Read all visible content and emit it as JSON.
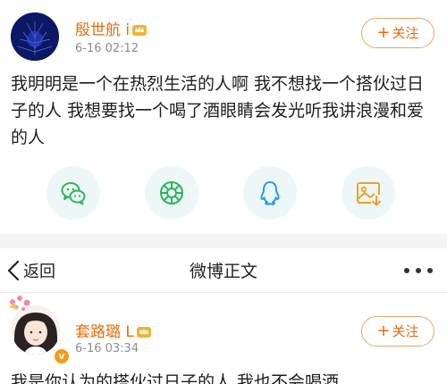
{
  "post1": {
    "username": "殷世航 i",
    "timestamp": "6-16 02:12",
    "follow_plus": "+",
    "follow_label": "关注",
    "text": "我明明是一个在热烈生活的人啊 我不想找一个搭伙过日子的人 我想要找一个喝了酒眼睛会发光听我讲浪漫和爱的人"
  },
  "share": {
    "icons": [
      "wechat-icon",
      "moments-icon",
      "qq-icon",
      "save-image-icon"
    ],
    "color_green": "#2bb55a",
    "color_blue": "#1e9cf0",
    "color_orange": "#f0a020"
  },
  "nav": {
    "back_label": "返回",
    "title": "微博正文",
    "more_icon": "more-dots-icon"
  },
  "post2": {
    "username": "套路璐 L",
    "timestamp": "6-16 03:34",
    "verify_mark": "v",
    "follow_plus": "+",
    "follow_label": "关注",
    "text": "我是你认为的搭伙过日子的人 我也不会喝酒"
  },
  "colors": {
    "accent": "#e86b0a",
    "follow_border": "#e8a46a",
    "muted": "#8c8c8c",
    "share_bg": "#eef7f7",
    "separator": "#f4f4f4"
  }
}
